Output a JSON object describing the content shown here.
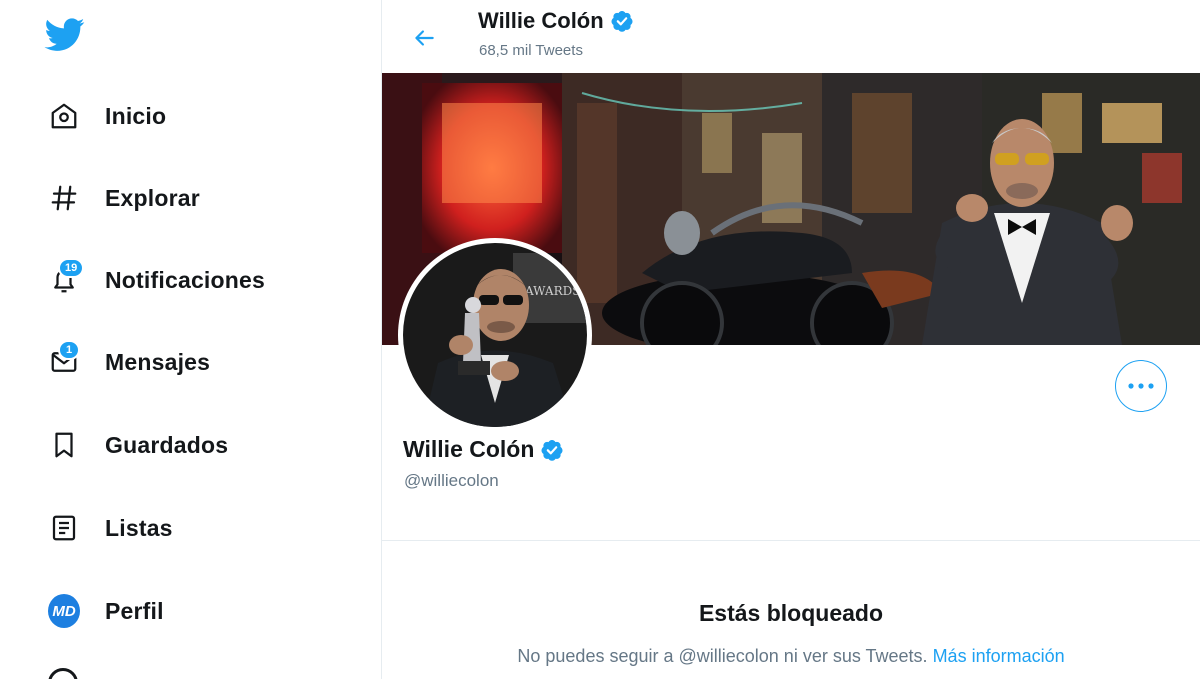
{
  "sidebar": {
    "items": [
      {
        "label": "Inicio",
        "icon": "home-icon"
      },
      {
        "label": "Explorar",
        "icon": "hashtag-icon"
      },
      {
        "label": "Notificaciones",
        "icon": "bell-icon",
        "badge": "19"
      },
      {
        "label": "Mensajes",
        "icon": "envelope-icon",
        "badge": "1"
      },
      {
        "label": "Guardados",
        "icon": "bookmark-icon"
      },
      {
        "label": "Listas",
        "icon": "list-icon"
      },
      {
        "label": "Perfil",
        "icon": "profile-avatar",
        "avatar_text": "MD"
      }
    ]
  },
  "header": {
    "title": "Willie Colón",
    "tweet_count": "68,5 mil Tweets"
  },
  "profile": {
    "name": "Willie Colón",
    "handle": "@williecolon",
    "verified": true
  },
  "blocked": {
    "title": "Estás bloqueado",
    "message": "No puedes seguir a @williecolon ni ver sus Tweets.",
    "link": "Más información"
  },
  "colors": {
    "accent": "#1da1f2",
    "text": "#14171a",
    "muted": "#657786",
    "border": "#e6ecf0"
  }
}
